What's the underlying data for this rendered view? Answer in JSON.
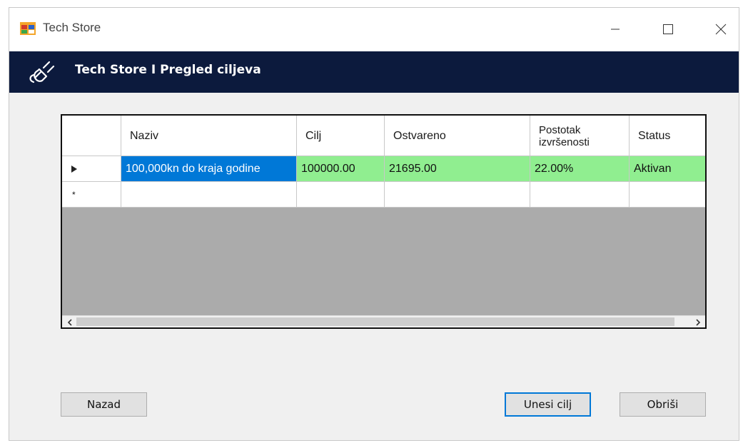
{
  "window": {
    "title": "Tech Store"
  },
  "header": {
    "title": "Tech Store I Pregled ciljeva",
    "icon": "plug-icon"
  },
  "grid": {
    "columns": [
      "Naziv",
      "Cilj",
      "Ostvareno",
      "Postotak izvršenosti",
      "Status"
    ],
    "column_header_lines": {
      "pct_line1": "Postotak",
      "pct_line2": "izvršenosti"
    },
    "rows": [
      {
        "indicator": "current-row-arrow",
        "naziv": "100,000kn do kraja godine",
        "cilj": "100000.00",
        "ostvareno": "21695.00",
        "postotak": "22.00%",
        "status": "Aktivan"
      }
    ],
    "new_row_indicator": "*",
    "colors": {
      "row_highlight": "#90ee90",
      "selected_cell": "#0078d7",
      "empty_area": "#ababab"
    }
  },
  "buttons": {
    "back": "Nazad",
    "add_goal": "Unesi cilj",
    "delete": "Obriši"
  }
}
